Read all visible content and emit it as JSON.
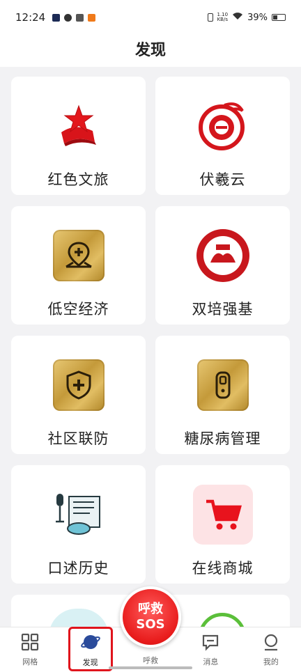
{
  "status_bar": {
    "time": "12:24",
    "speed_value": "1.10",
    "speed_unit": "KB/s",
    "battery": "39%"
  },
  "header": {
    "title": "发现"
  },
  "cards": [
    {
      "label": "红色文旅",
      "icon": "red-star-flag-icon"
    },
    {
      "label": "伏羲云",
      "icon": "fuxi-dragon-icon"
    },
    {
      "label": "低空经济",
      "icon": "map-pin-plus-icon"
    },
    {
      "label": "双培强基",
      "icon": "shuangpei-badge-icon"
    },
    {
      "label": "社区联防",
      "icon": "shield-plus-icon"
    },
    {
      "label": "糖尿病管理",
      "icon": "glucose-meter-icon"
    },
    {
      "label": "口述历史",
      "icon": "microphone-scroll-icon"
    },
    {
      "label": "在线商城",
      "icon": "shopping-cart-icon"
    }
  ],
  "sos": {
    "line1": "呼救",
    "line2": "SOS"
  },
  "nav": [
    {
      "label": "网格",
      "icon": "grid-icon"
    },
    {
      "label": "发现",
      "icon": "planet-icon",
      "active": true
    },
    {
      "label": "呼救",
      "icon": "sos-icon"
    },
    {
      "label": "消息",
      "icon": "message-icon"
    },
    {
      "label": "我的",
      "icon": "user-icon"
    }
  ],
  "colors": {
    "accent_red": "#e0141c",
    "gold": "#c49a3a",
    "nav_blue": "#2b4b9b"
  }
}
